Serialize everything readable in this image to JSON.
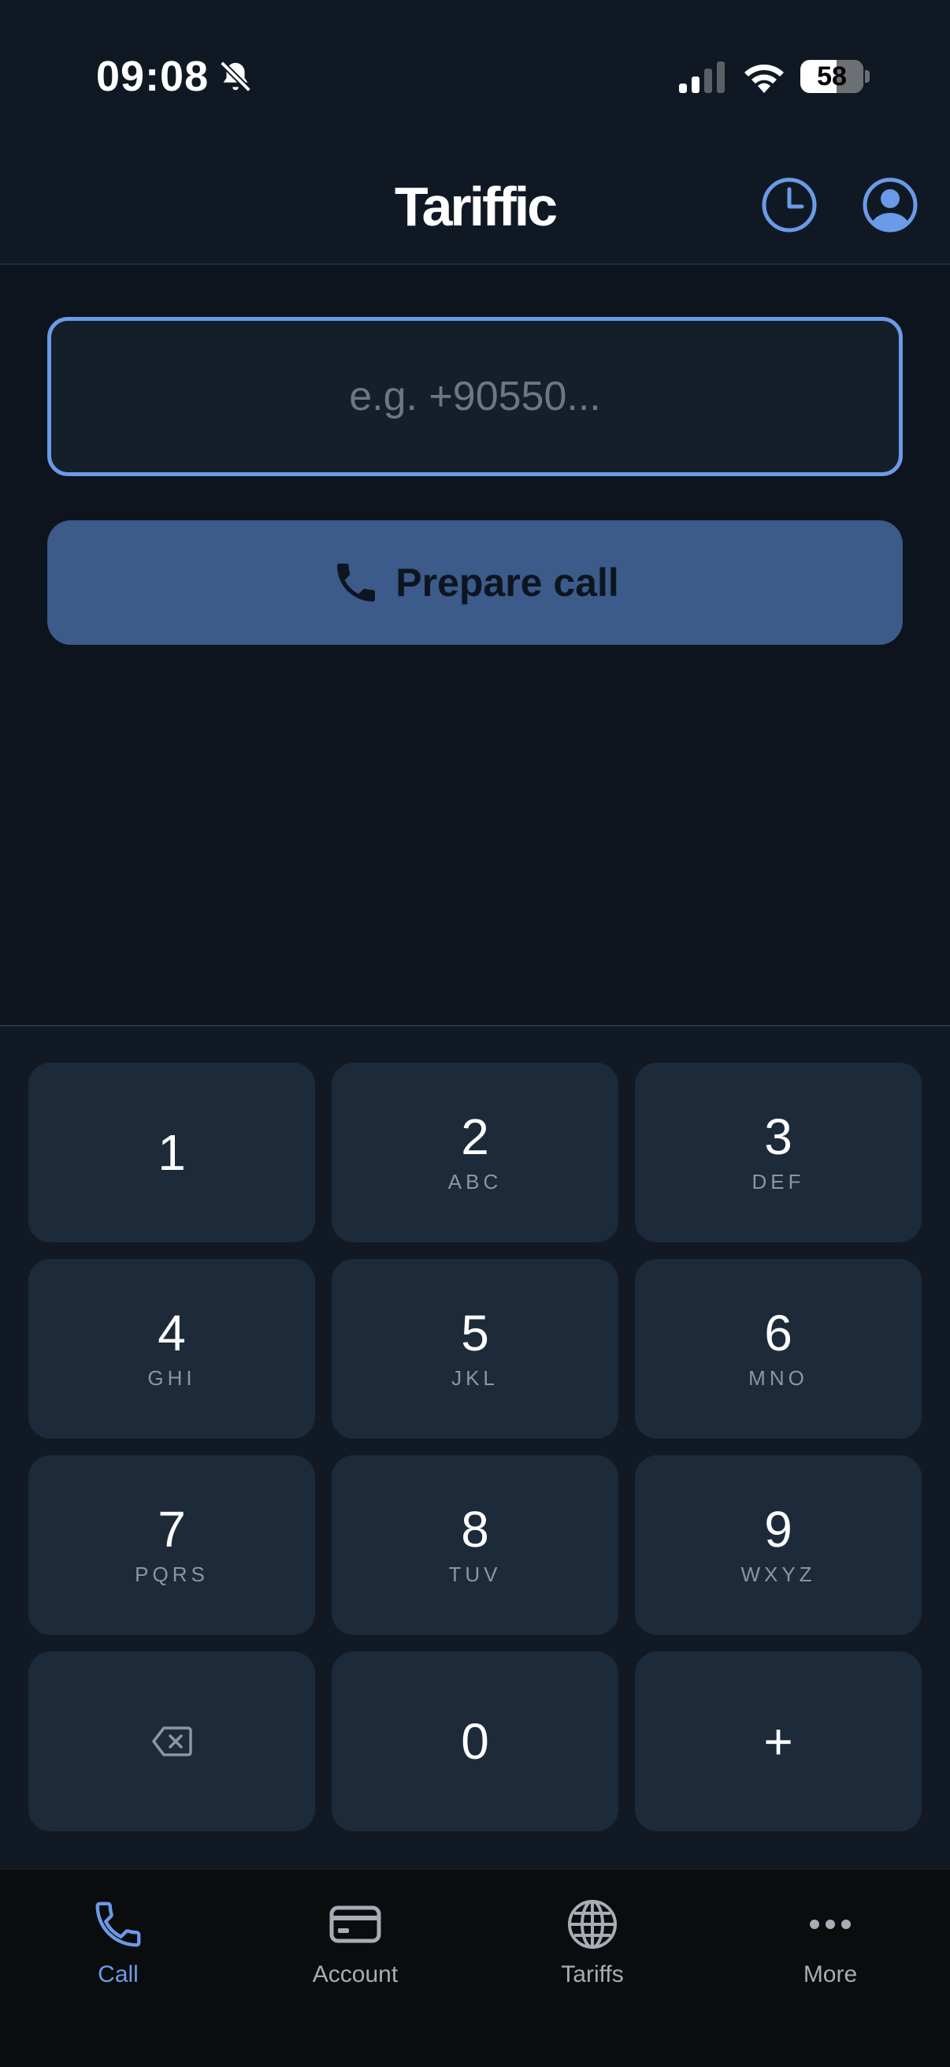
{
  "status_bar": {
    "time": "09:08",
    "battery": "58"
  },
  "header": {
    "title": "Tariffic"
  },
  "dialer": {
    "input_value": "",
    "input_placeholder": "e.g. +90550...",
    "prepare_label": "Prepare call"
  },
  "keypad": {
    "keys": [
      {
        "digit": "1",
        "letters": ""
      },
      {
        "digit": "2",
        "letters": "ABC"
      },
      {
        "digit": "3",
        "letters": "DEF"
      },
      {
        "digit": "4",
        "letters": "GHI"
      },
      {
        "digit": "5",
        "letters": "JKL"
      },
      {
        "digit": "6",
        "letters": "MNO"
      },
      {
        "digit": "7",
        "letters": "PQRS"
      },
      {
        "digit": "8",
        "letters": "TUV"
      },
      {
        "digit": "9",
        "letters": "WXYZ"
      },
      {
        "digit": "0",
        "letters": ""
      },
      {
        "digit": "+",
        "letters": ""
      }
    ]
  },
  "tabbar": {
    "items": [
      {
        "label": "Call",
        "icon": "phone-icon",
        "active": true
      },
      {
        "label": "Account",
        "icon": "credit-card-icon",
        "active": false
      },
      {
        "label": "Tariffs",
        "icon": "globe-icon",
        "active": false
      },
      {
        "label": "More",
        "icon": "ellipsis-icon",
        "active": false
      }
    ]
  },
  "colors": {
    "accent": "#6b9ae8",
    "button": "#3c5a8a",
    "key_bg": "#1c2a3a",
    "background": "#0d141d"
  }
}
